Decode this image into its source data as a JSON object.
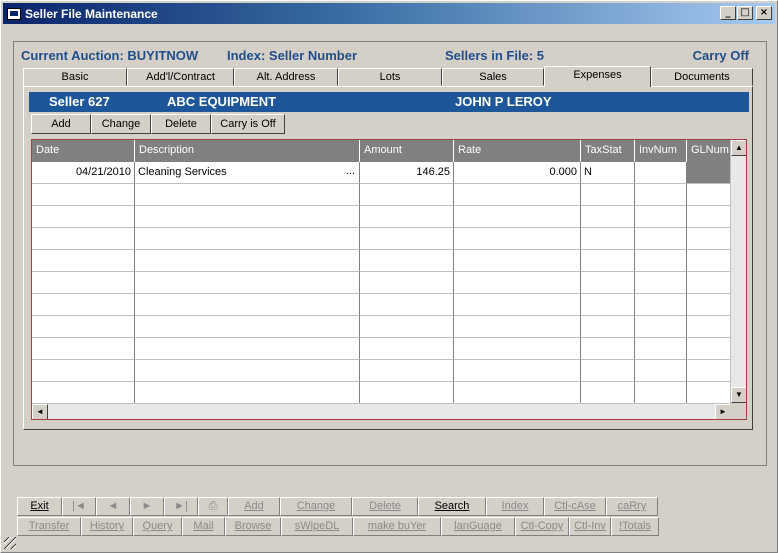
{
  "window": {
    "title": "Seller File Maintenance",
    "minimize": "_",
    "maximize": "□",
    "close": "×"
  },
  "info": {
    "auction": "Current Auction: BUYITNOW",
    "index": "Index: Seller Number",
    "sellers": "Sellers in File: 5",
    "carry": "Carry Off"
  },
  "tabs": [
    {
      "label": "Basic"
    },
    {
      "label": "Add'l/Contract"
    },
    {
      "label": "Alt. Address"
    },
    {
      "label": "Lots"
    },
    {
      "label": "Sales"
    },
    {
      "label": "Expenses",
      "active": true
    },
    {
      "label": "Documents"
    }
  ],
  "seller": {
    "number": "Seller 627",
    "company": "ABC EQUIPMENT",
    "name": "JOHN P LEROY",
    "bar_color": "#1e5799"
  },
  "actions": {
    "add": "Add",
    "change": "Change",
    "delete": "Delete",
    "carry": "Carry is Off"
  },
  "grid": {
    "columns": [
      "Date",
      "Description",
      "Amount",
      "Rate",
      "TaxStat",
      "InvNum",
      "GLNum"
    ],
    "rows": [
      {
        "date": "04/21/2010",
        "description": "Cleaning Services",
        "ellipsis": "...",
        "amount": "146.25",
        "rate": "0.000",
        "taxstat": "N",
        "invnum": "",
        "glnum": ""
      }
    ]
  },
  "bottom": {
    "row1": [
      {
        "label": "Exit",
        "enabled": true
      },
      {
        "label": "|◄",
        "enabled": false
      },
      {
        "label": "◄",
        "enabled": false
      },
      {
        "label": "►",
        "enabled": false
      },
      {
        "label": "►|",
        "enabled": false
      },
      {
        "label": "⎙",
        "enabled": false
      },
      {
        "label": "Add",
        "enabled": false
      },
      {
        "label": "Change",
        "enabled": false
      },
      {
        "label": "Delete",
        "enabled": false
      },
      {
        "label": "Search",
        "enabled": true
      },
      {
        "label": "Index",
        "enabled": false
      },
      {
        "label": "Ctl-cAse",
        "enabled": false
      },
      {
        "label": "caRry",
        "enabled": false
      }
    ],
    "row2": [
      {
        "label": "Transfer",
        "enabled": false
      },
      {
        "label": "History",
        "enabled": false
      },
      {
        "label": "Query",
        "enabled": false
      },
      {
        "label": "Mail",
        "enabled": false
      },
      {
        "label": "Browse",
        "enabled": false
      },
      {
        "label": "sWipeDL",
        "enabled": false
      },
      {
        "label": "make buYer",
        "enabled": false
      },
      {
        "label": "lanGuage",
        "enabled": false
      },
      {
        "label": "Ctl-Copy",
        "enabled": false
      },
      {
        "label": "Ctl-Inv",
        "enabled": false
      },
      {
        "label": "!Totals",
        "enabled": false
      }
    ]
  }
}
